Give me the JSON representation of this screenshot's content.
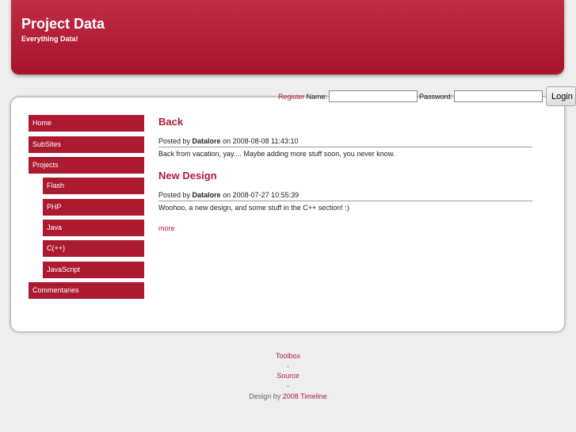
{
  "header": {
    "title": "Project Data",
    "subtitle": "Everything Data!"
  },
  "login": {
    "register": "Register",
    "name_label": "Name:",
    "name_value": "",
    "password_label": "Password:",
    "password_value": "",
    "button": "Login"
  },
  "nav": [
    {
      "label": "Home"
    },
    {
      "label": "SubSites"
    },
    {
      "label": "Projects"
    },
    {
      "label": "Flash"
    },
    {
      "label": "PHP"
    },
    {
      "label": "Java"
    },
    {
      "label": "C(++)"
    },
    {
      "label": "JavaScript"
    },
    {
      "label": "Commentaries"
    }
  ],
  "posts": [
    {
      "title": "Back",
      "posted_by": "Posted by",
      "author": "Datalore",
      "on": "on 2008-08-08 11:43:10",
      "body": "Back from vacation, yay.... Maybe adding more stuff soon, you never know."
    },
    {
      "title": "New Design",
      "posted_by": "Posted by",
      "author": "Datalore",
      "on": "on 2008-07-27 10:55:39",
      "body": "Woohoo, a new design, and some stuff in the C++ section! :)"
    }
  ],
  "more": "more",
  "footer": {
    "toolbox": "Toolbox",
    "sep": "-",
    "source": "Source",
    "design_by": "Design by",
    "designer": "2008 Timeline"
  }
}
